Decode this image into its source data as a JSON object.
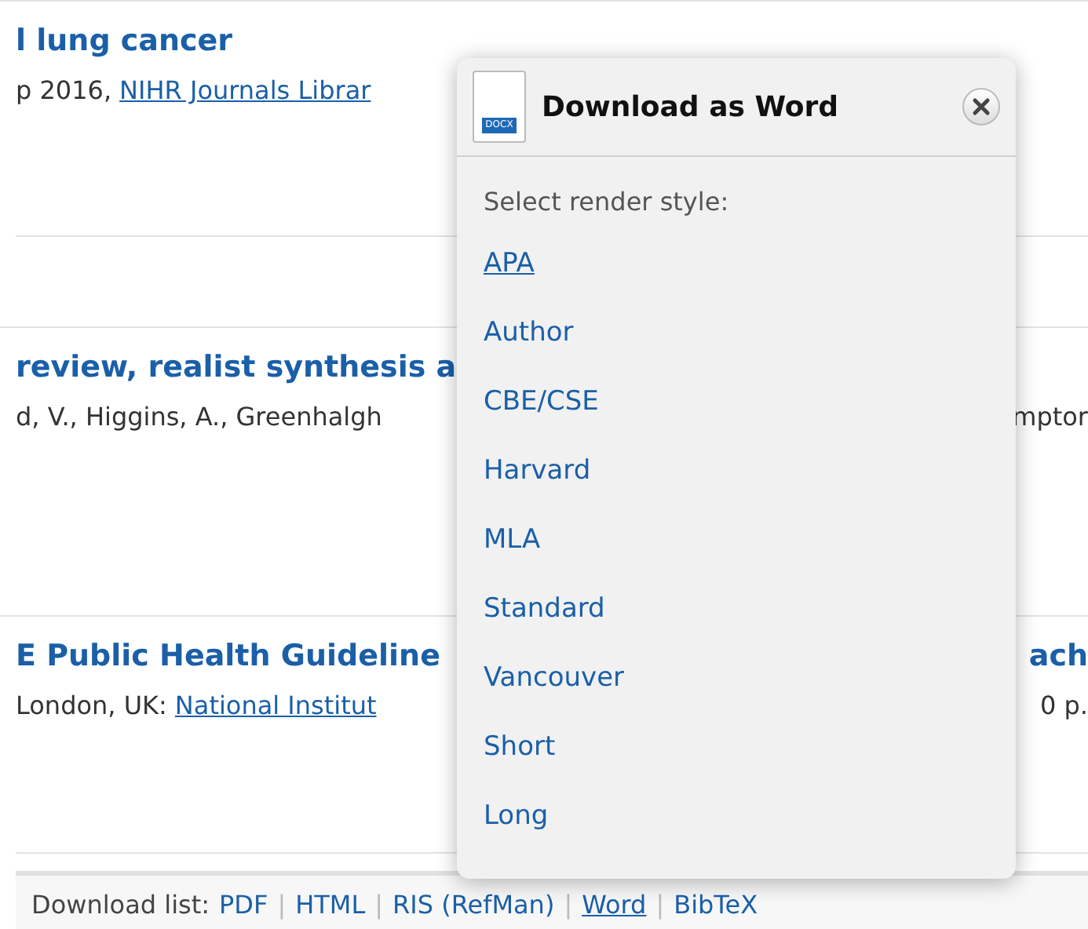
{
  "entries": [
    {
      "title": "l lung cancer",
      "detail_text": "p 2016, ",
      "detail_link": "NIHR Journals Librar"
    },
    {
      "title": "review, realist synthesis a",
      "detail_text": "d, V., Higgins, A., Greenhalgh",
      "detail_right": "mptor"
    },
    {
      "title": "E Public Health Guideline",
      "title_right": "ach",
      "detail_text": "London, UK: ",
      "detail_link": "National Institut",
      "detail_right": "0 p."
    }
  ],
  "download_list": {
    "label": "Download list:",
    "formats": [
      {
        "label": "PDF",
        "selected": false
      },
      {
        "label": "HTML",
        "selected": false
      },
      {
        "label": "RIS (RefMan)",
        "selected": false
      },
      {
        "label": "Word",
        "selected": true
      },
      {
        "label": "BibTeX",
        "selected": false
      }
    ],
    "separator": "|"
  },
  "popup": {
    "file_badge": "DOCX",
    "title": "Download as Word",
    "prompt": "Select render style:",
    "styles": [
      {
        "label": "APA",
        "selected": true
      },
      {
        "label": "Author",
        "selected": false
      },
      {
        "label": "CBE/CSE",
        "selected": false
      },
      {
        "label": "Harvard",
        "selected": false
      },
      {
        "label": "MLA",
        "selected": false
      },
      {
        "label": "Standard",
        "selected": false
      },
      {
        "label": "Vancouver",
        "selected": false
      },
      {
        "label": "Short",
        "selected": false
      },
      {
        "label": "Long",
        "selected": false
      }
    ]
  }
}
